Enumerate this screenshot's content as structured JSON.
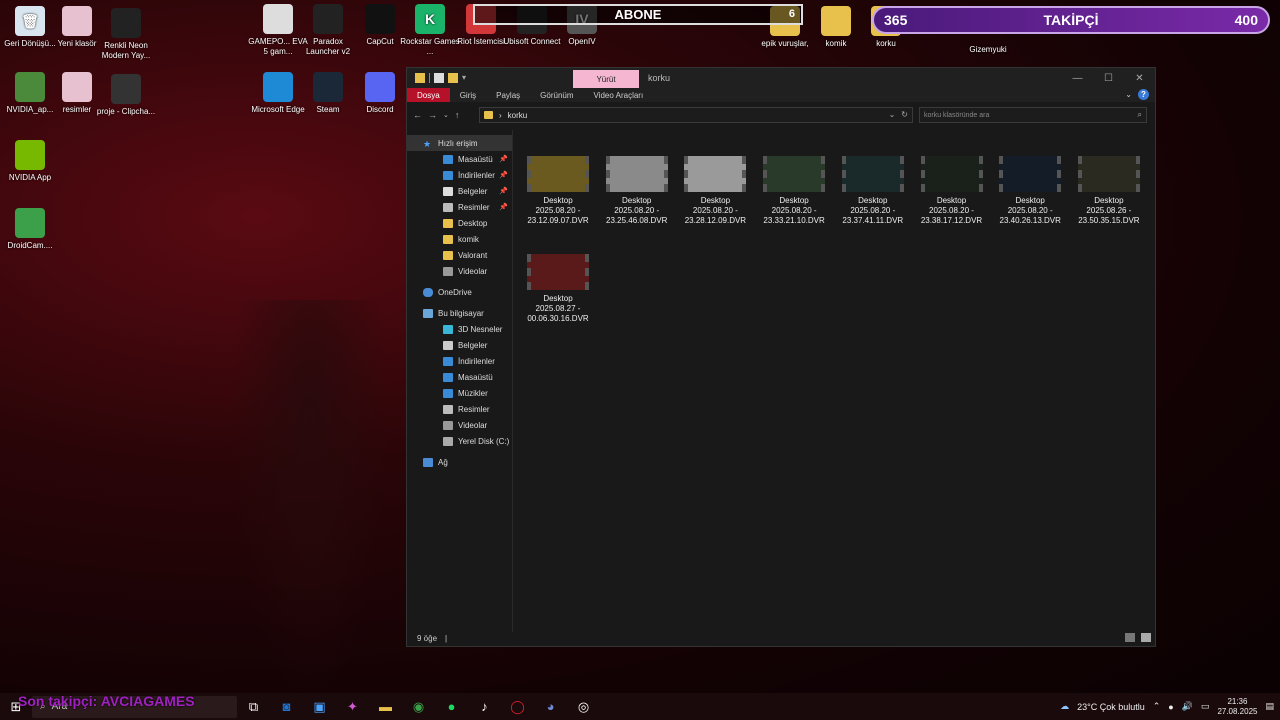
{
  "desktop": {
    "icons": [
      {
        "label": "Geri Dönüşü...",
        "glyph": "🗑"
      },
      {
        "label": "Yeni klasör",
        "glyph": ""
      },
      {
        "label": "Renkli Neon Modern Yay...",
        "glyph": ""
      },
      {
        "label": "NVIDIA_ap...",
        "glyph": ""
      },
      {
        "label": "resimler",
        "glyph": ""
      },
      {
        "label": "proje - Clipcha...",
        "glyph": ""
      },
      {
        "label": "NVIDIA App",
        "glyph": ""
      },
      {
        "label": "DroidCam....",
        "glyph": ""
      },
      {
        "label": "GAMEPO... EVA 5 gam...",
        "glyph": ""
      },
      {
        "label": "Paradox Launcher v2",
        "glyph": ""
      },
      {
        "label": "CapCut",
        "glyph": ""
      },
      {
        "label": "Rockstar Games ...",
        "glyph": "K"
      },
      {
        "label": "Riot İstemcisi",
        "glyph": ""
      },
      {
        "label": "Ubisoft Connect",
        "glyph": ""
      },
      {
        "label": "OpenIV",
        "glyph": "IV"
      },
      {
        "label": "Microsoft Edge",
        "glyph": ""
      },
      {
        "label": "Steam",
        "glyph": ""
      },
      {
        "label": "Discord",
        "glyph": ""
      },
      {
        "label": "epik vuruşlar,",
        "glyph": ""
      },
      {
        "label": "komik",
        "glyph": ""
      },
      {
        "label": "korku",
        "glyph": ""
      },
      {
        "label": "Gizemyuki",
        "glyph": ""
      }
    ]
  },
  "overlay": {
    "abone": "ABONE",
    "abone_count": "6",
    "takipci_current": "365",
    "takipci_label": "TAKİPÇİ",
    "takipci_goal": "400",
    "ticker": "Son takipçi: AVCIAGAMES"
  },
  "explorer": {
    "ribbon_context_tab": "Yürüt",
    "window_title": "korku",
    "ribbon_tabs": [
      "Dosya",
      "Giriş",
      "Paylaş",
      "Görünüm",
      "Video Araçları"
    ],
    "address": "korku",
    "search_placeholder": "korku klasöründe ara",
    "sidebar": {
      "quick_access": "Hızlı erişim",
      "quick_items": [
        "Masaüstü",
        "İndirilenler",
        "Belgeler",
        "Resimler",
        "Desktop",
        "komik",
        "Valorant",
        "Videolar"
      ],
      "onedrive": "OneDrive",
      "this_pc": "Bu bilgisayar",
      "pc_items": [
        "3D Nesneler",
        "Belgeler",
        "İndirilenler",
        "Masaüstü",
        "Müzikler",
        "Resimler",
        "Videolar",
        "Yerel Disk (C:)"
      ],
      "network": "Ağ"
    },
    "files": [
      {
        "line1": "Desktop",
        "line2": "2025.08.20 -",
        "line3": "23.12.09.07.DVR",
        "color": "#6b5a20"
      },
      {
        "line1": "Desktop",
        "line2": "2025.08.20 -",
        "line3": "23.25.46.08.DVR",
        "color": "#8a8a8a"
      },
      {
        "line1": "Desktop",
        "line2": "2025.08.20 -",
        "line3": "23.28.12.09.DVR",
        "color": "#9a9a9a"
      },
      {
        "line1": "Desktop",
        "line2": "2025.08.20 -",
        "line3": "23.33.21.10.DVR",
        "color": "#2a3a2a"
      },
      {
        "line1": "Desktop",
        "line2": "2025.08.20 -",
        "line3": "23.37.41.11.DVR",
        "color": "#1a2a2a"
      },
      {
        "line1": "Desktop",
        "line2": "2025.08.20 -",
        "line3": "23.38.17.12.DVR",
        "color": "#1a201a"
      },
      {
        "line1": "Desktop",
        "line2": "2025.08.20 -",
        "line3": "23.40.26.13.DVR",
        "color": "#141c28"
      },
      {
        "line1": "Desktop",
        "line2": "2025.08.26 -",
        "line3": "23.50.35.15.DVR",
        "color": "#2a2a20"
      },
      {
        "line1": "Desktop",
        "line2": "2025.08.27 -",
        "line3": "00.06.30.16.DVR",
        "color": "#5a1a1a"
      }
    ],
    "status_count": "9 öğe"
  },
  "taskbar": {
    "search_label": "Ara",
    "weather": "23°C  Çok bulutlu",
    "time": "21:36",
    "date": "27.08.2025"
  }
}
